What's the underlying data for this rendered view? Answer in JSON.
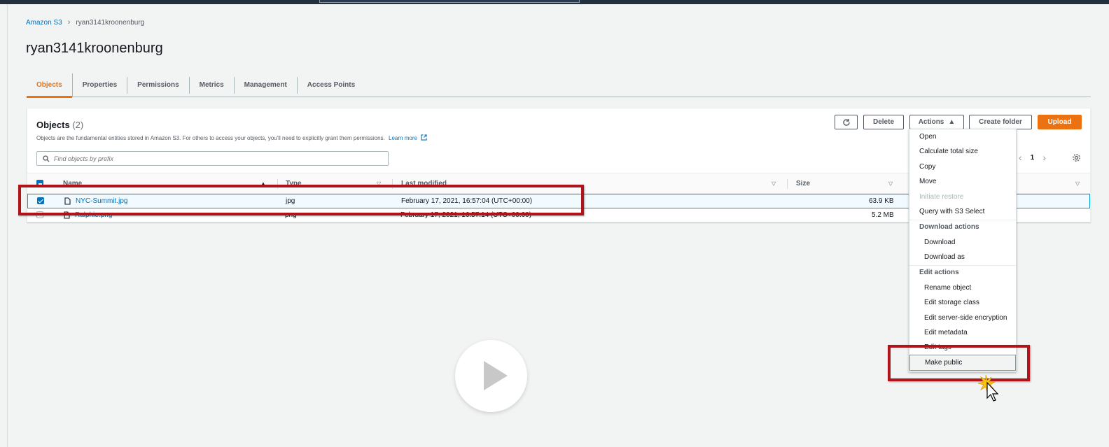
{
  "breadcrumb": {
    "root": "Amazon S3",
    "current": "ryan3141kroonenburg"
  },
  "page_title": "ryan3141kroonenburg",
  "tabs": [
    "Objects",
    "Properties",
    "Permissions",
    "Metrics",
    "Management",
    "Access Points"
  ],
  "active_tab": "Objects",
  "objects_panel": {
    "title": "Objects",
    "count": "(2)",
    "description": "Objects are the fundamental entities stored in Amazon S3. For others to access your objects, you'll need to explicitly grant them permissions.",
    "learn_more": "Learn more",
    "search_placeholder": "Find objects by prefix",
    "buttons": {
      "delete": "Delete",
      "actions": "Actions",
      "create_folder": "Create folder",
      "upload": "Upload"
    },
    "page_number": "1",
    "columns": {
      "name": "Name",
      "type": "Type",
      "last_modified": "Last modified",
      "size": "Size"
    },
    "rows": [
      {
        "name": "NYC-Summit.jpg",
        "type": "jpg",
        "last_modified": "February 17, 2021, 16:57:04 (UTC+00:00)",
        "size": "63.9 KB",
        "selected": true
      },
      {
        "name": "Ralphie.png",
        "type": "png",
        "last_modified": "February 17, 2021, 16:57:14 (UTC+00:00)",
        "size": "5.2 MB",
        "selected": false
      }
    ]
  },
  "actions_menu": {
    "items": [
      "Open",
      "Calculate total size",
      "Copy",
      "Move",
      "Initiate restore",
      "Query with S3 Select"
    ],
    "download_header": "Download actions",
    "download_items": [
      "Download",
      "Download as"
    ],
    "edit_header": "Edit actions",
    "edit_items": [
      "Rename object",
      "Edit storage class",
      "Edit server-side encryption",
      "Edit metadata",
      "Edit tags"
    ],
    "make_public": "Make public"
  },
  "colors": {
    "accent": "#ec7211",
    "link": "#0073bb",
    "highlight_box": "#b0141a"
  },
  "icons": [
    "refresh-icon",
    "external-link-icon",
    "search-icon",
    "gear-icon",
    "file-icon",
    "play-icon",
    "cursor-icon"
  ]
}
